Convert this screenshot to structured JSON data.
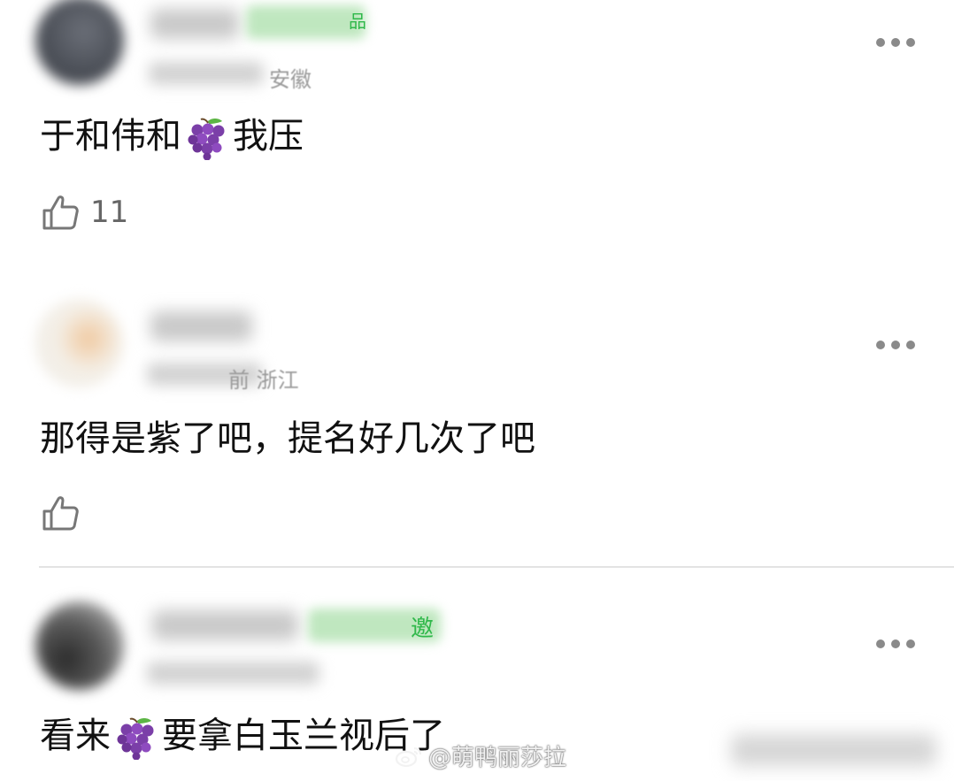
{
  "comments": [
    {
      "badge_suffix": "品",
      "meta_suffix": "安徽",
      "text_before": "于和伟和",
      "text_after": "我压",
      "like_count": "11"
    },
    {
      "meta_suffix": "前 浙江",
      "text": "那得是紫了吧，提名好几次了吧",
      "like_count": ""
    },
    {
      "badge_suffix": "邀",
      "text_before": "看来",
      "text_after": "要拿白玉兰视后了"
    }
  ],
  "watermark": {
    "label": "@萌鸭丽莎拉",
    "icon": "weibo-icon"
  },
  "emoji": {
    "grape": "grapes-emoji"
  }
}
